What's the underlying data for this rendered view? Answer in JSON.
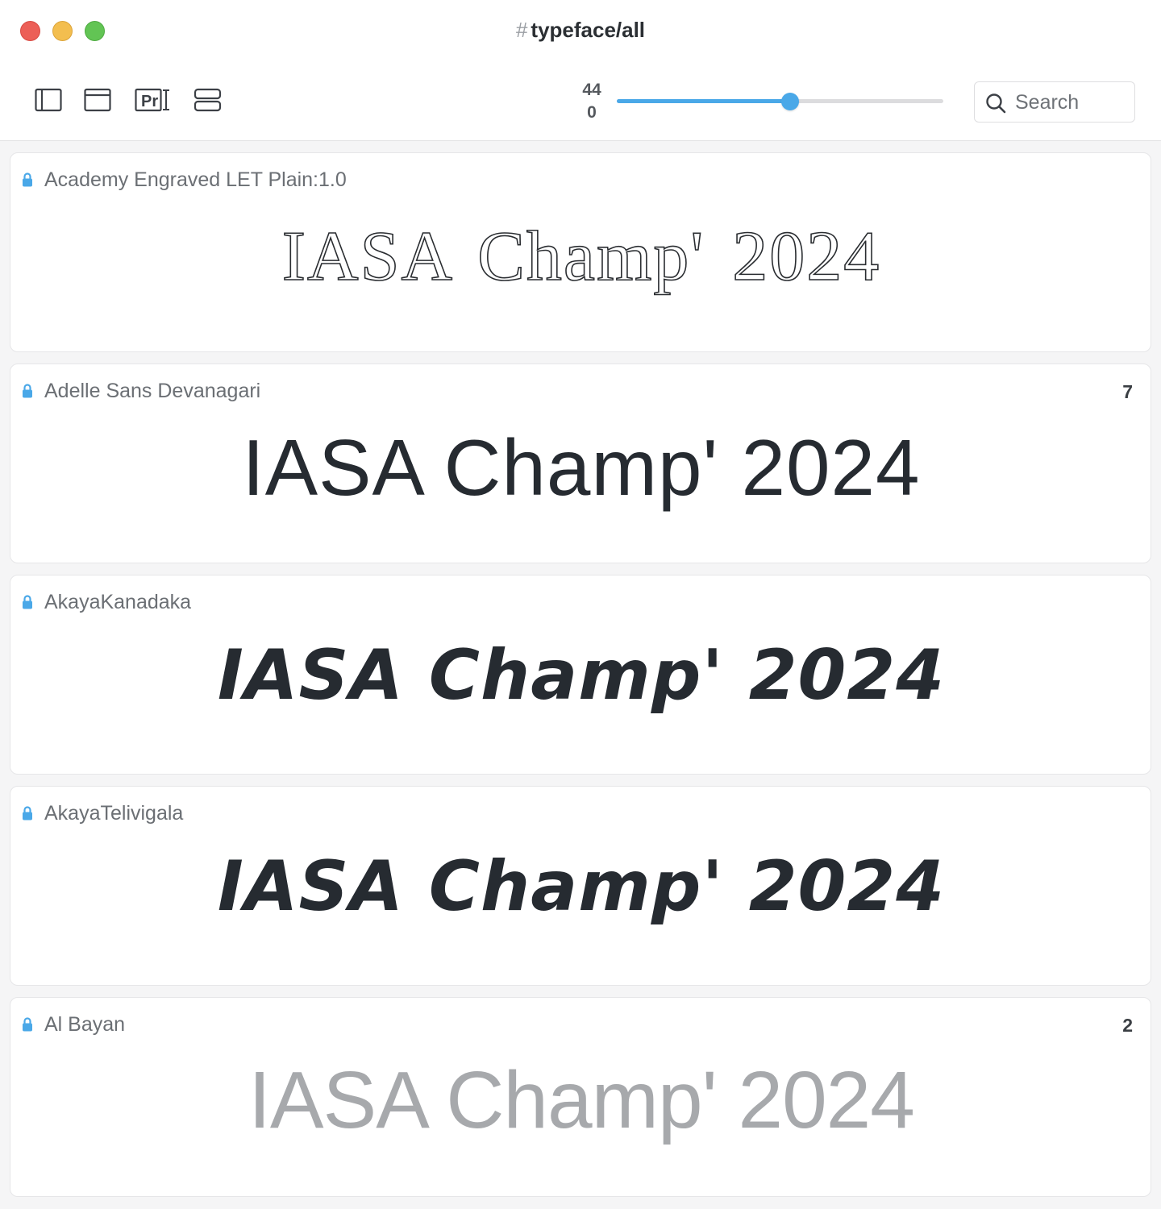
{
  "window": {
    "title_hash": "#",
    "title": "typeface/all"
  },
  "toolbar": {
    "icons": [
      "sidebar-icon",
      "window-icon",
      "preview-text-icon",
      "list-layout-icon"
    ],
    "preview_text_icon_label": "Pr",
    "size_value": "44",
    "size_secondary": "0",
    "slider": {
      "level": 0.53,
      "accent": "#4aa8e8"
    },
    "search": {
      "placeholder": "Search",
      "value": ""
    }
  },
  "sample_text": "IASA Champ' 2024",
  "fonts": [
    {
      "name": "Academy Engraved LET Plain:1.0",
      "count": "",
      "style": "engraved"
    },
    {
      "name": "Adelle Sans Devanagari",
      "count": "7",
      "style": "sans"
    },
    {
      "name": "AkayaKanadaka",
      "count": "",
      "style": "handwritten"
    },
    {
      "name": "AkayaTelivigala",
      "count": "",
      "style": "handwritten"
    },
    {
      "name": "Al Bayan",
      "count": "2",
      "style": "light"
    }
  ],
  "colors": {
    "accent": "#4aa8e8",
    "lock_icon": "#4aa8e8"
  }
}
